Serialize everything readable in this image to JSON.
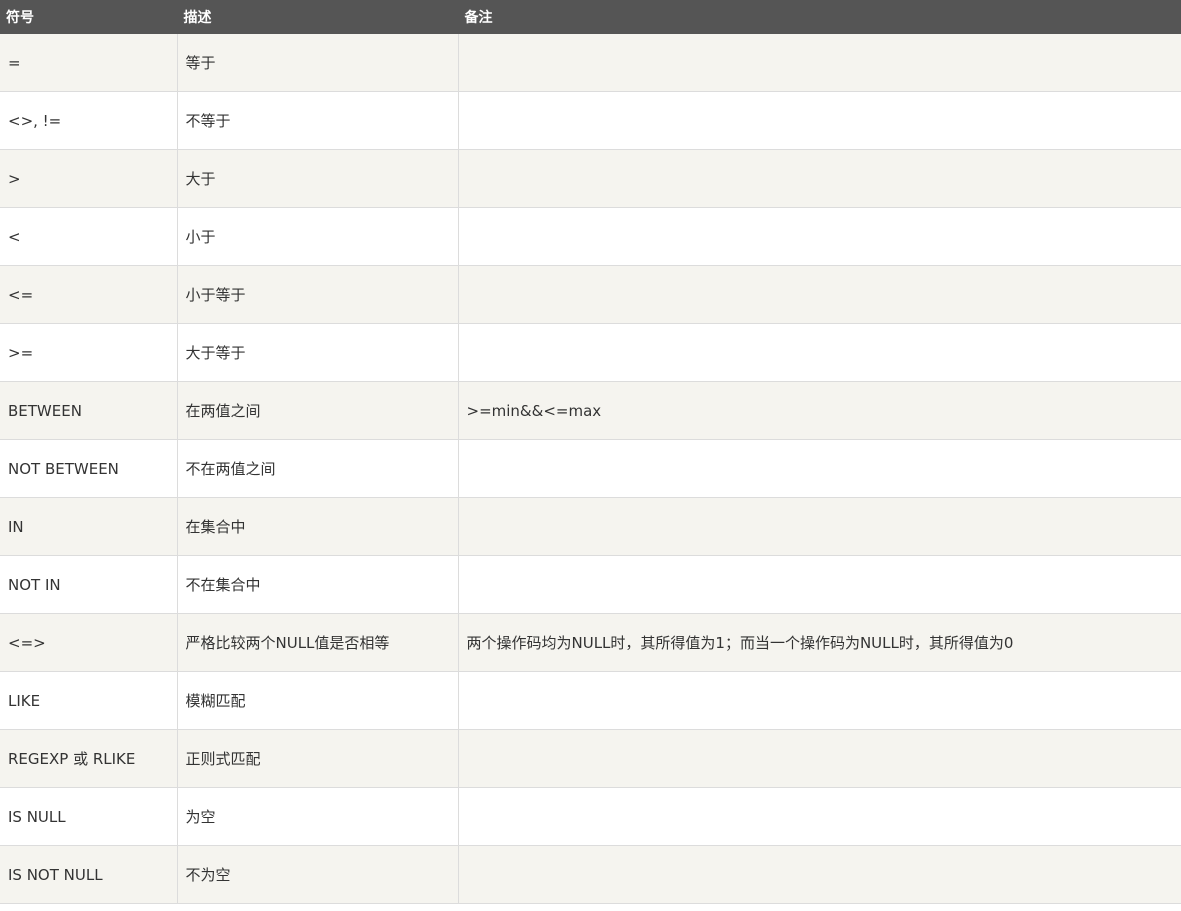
{
  "table": {
    "headers": [
      "符号",
      "描述",
      "备注"
    ],
    "rows": [
      [
        "=",
        "等于",
        ""
      ],
      [
        "<>, !=",
        "不等于",
        ""
      ],
      [
        ">",
        "大于",
        ""
      ],
      [
        "<",
        "小于",
        ""
      ],
      [
        "<=",
        "小于等于",
        ""
      ],
      [
        ">=",
        "大于等于",
        ""
      ],
      [
        "BETWEEN",
        "在两值之间",
        ">=min&&<=max"
      ],
      [
        "NOT BETWEEN",
        "不在两值之间",
        ""
      ],
      [
        "IN",
        "在集合中",
        ""
      ],
      [
        "NOT IN",
        "不在集合中",
        ""
      ],
      [
        "<=>",
        "严格比较两个NULL值是否相等",
        "两个操作码均为NULL时，其所得值为1；而当一个操作码为NULL时，其所得值为0"
      ],
      [
        "LIKE",
        "模糊匹配",
        ""
      ],
      [
        "REGEXP 或 RLIKE",
        "正则式匹配",
        ""
      ],
      [
        "IS NULL",
        "为空",
        ""
      ],
      [
        "IS NOT NULL",
        "不为空",
        ""
      ]
    ]
  }
}
